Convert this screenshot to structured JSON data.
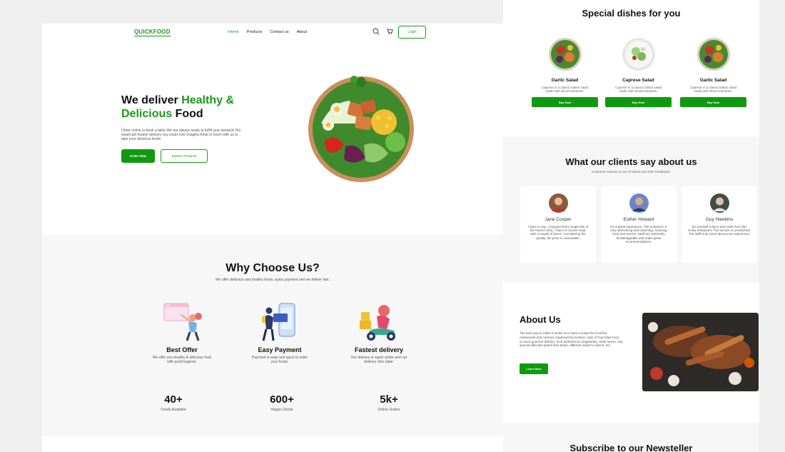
{
  "landing": {
    "nav": {
      "logo": "QUICKFOOD",
      "links": [
        "Home",
        "Products",
        "Contact us",
        "About"
      ],
      "login_label": "Login"
    },
    "hero": {
      "title_part1": "We deliver ",
      "title_green": "Healthy & Delicious",
      "title_part2": " Food",
      "description": "Order online or book a table.We are always ready to fulfill your demand.You would get fastest delivery you could ever imagine.Keep in touch with us to take your delicious foods.",
      "order_label": "Order Now",
      "explore_label": "Explore Products"
    },
    "why": {
      "title": "Why Choose Us?",
      "subtitle": "We offer delicious and healthy foods, quick payment and we deliver fast.",
      "features": [
        {
          "title": "Best Offer",
          "desc": "We offer you healthy & delicious food with good hygiene."
        },
        {
          "title": "Easy Payment",
          "desc": "Payment is easy and quick to order your foods."
        },
        {
          "title": "Fastest delivery",
          "desc": "Our delivery is super active and run delivery inter state."
        }
      ],
      "stats": [
        {
          "value": "40+",
          "label": "Foods Available"
        },
        {
          "value": "600+",
          "label": "Happy Clients"
        },
        {
          "value": "5k+",
          "label": "Online Orders"
        }
      ]
    }
  },
  "specials": {
    "title": "Special dishes for you",
    "dishes": [
      {
        "name": "Garlic Salad",
        "desc": "Caprese is a classic Italian salad made with sliced tomatoes.",
        "button": "Buy Now"
      },
      {
        "name": "Caprese Salad",
        "desc": "Caprese is a classic Italian salad made with sliced tomatoes.",
        "button": "Buy Now"
      },
      {
        "name": "Garlic Salad",
        "desc": "Caprese is a classic Italian salad made with sliced tomatoes.",
        "button": "Buy Now"
      }
    ]
  },
  "reviews": {
    "title": "What our clients say about us",
    "subtitle": "Customer reviews on our Products and their feedbacks.",
    "cards": [
      {
        "name": "Jane Cooper",
        "text": "I have to say, I enjoyed every single bite of the meal in (Rs). I had a 3 course meal, with a couple of beers. Considering the quality, the price is reasonable."
      },
      {
        "name": "Esther Howard",
        "text": "It's a great experience. The ambiance is very welcoming and charming. Amazing food and service. Staff are extremely knowledgeable and make great recommendations."
      },
      {
        "name": "Guy Hawkins",
        "text": "Do yourself a favor and order from this lovely restaurant. The service is unmatched. The staff truly cares about your experience."
      }
    ]
  },
  "about": {
    "title": "About Us",
    "text": "The best way to make it works is to have a smart list of all the restaurants and cuisines organized by location, type of food (fast food, or more gourmet dishes), food preferences (vegetarian, meat lovers, any special diets like gluten-free diets), different nation's cuisine, etc.",
    "button": "Learn More"
  },
  "newsletter": {
    "title": "Subscribe to our Newsteller"
  },
  "colors": {
    "brand_green": "#1a9a1a",
    "button_green": "#0f9a0f",
    "section_gray": "#f7f7f7"
  }
}
